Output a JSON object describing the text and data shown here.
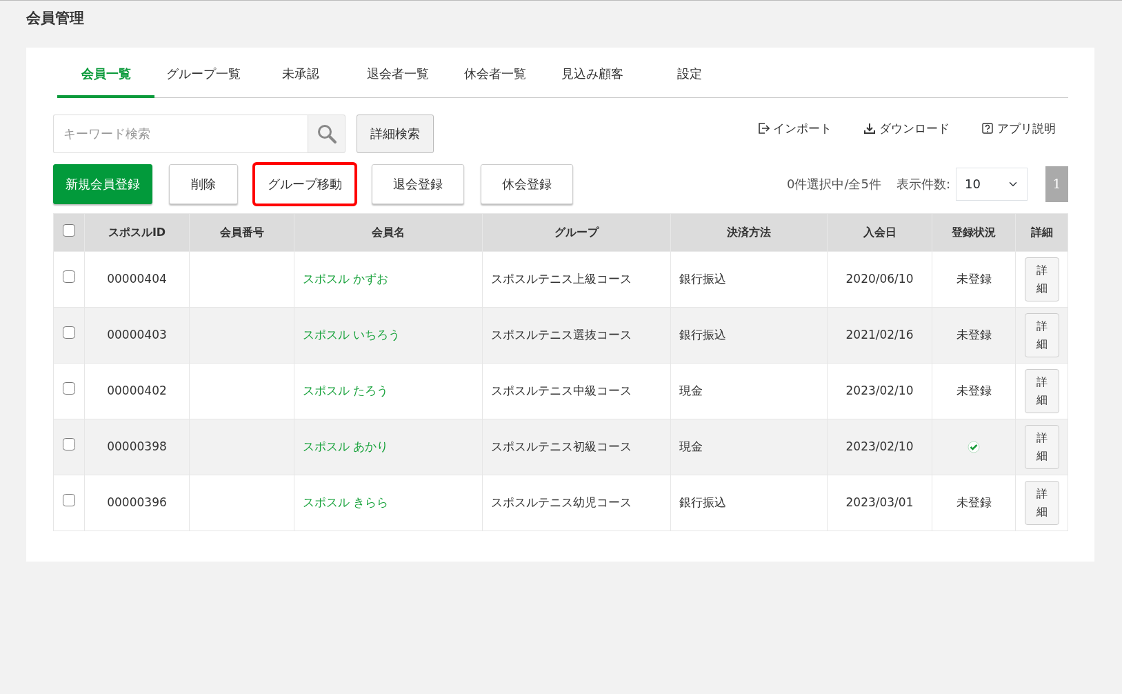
{
  "page_title": "会員管理",
  "tabs": [
    {
      "label": "会員一覧",
      "selected": true
    },
    {
      "label": "グループ一覧",
      "selected": false
    },
    {
      "label": "未承認",
      "selected": false
    },
    {
      "label": "退会者一覧",
      "selected": false
    },
    {
      "label": "休会者一覧",
      "selected": false
    },
    {
      "label": "見込み顧客",
      "selected": false
    },
    {
      "label": "設定",
      "selected": false
    }
  ],
  "search": {
    "placeholder": "キーワード検索",
    "advanced_button": "詳細検索"
  },
  "links": [
    {
      "kind": "import",
      "label": "インポート"
    },
    {
      "kind": "download",
      "label": "ダウンロード"
    },
    {
      "kind": "help",
      "label": "アプリ説明"
    }
  ],
  "actions": [
    {
      "kind": "primary",
      "label": "新規会員登録",
      "highlighted": false
    },
    {
      "kind": "default",
      "label": "削除",
      "highlighted": false
    },
    {
      "kind": "default",
      "label": "グループ移動",
      "highlighted": true
    },
    {
      "kind": "default",
      "label": "退会登録",
      "highlighted": false
    },
    {
      "kind": "default",
      "label": "休会登録",
      "highlighted": false
    }
  ],
  "selection_info": "0件選択中/全5件",
  "page_size_label": "表示件数:",
  "page_size": "10",
  "pages": [
    {
      "label": "1",
      "selected": true
    }
  ],
  "table": {
    "select_all_checked": false,
    "columns": [
      "スポスルID",
      "会員番号",
      "会員名",
      "グループ",
      "決済方法",
      "入会日",
      "登録状況",
      "詳細"
    ],
    "rows": [
      {
        "checked": false,
        "id": "00000404",
        "name": "スポスル かずお",
        "group": "スポスルテニス上級コース",
        "payment": "銀行振込",
        "joined": "2020/06/10",
        "registered": false,
        "status": "未登録",
        "detail": "詳細"
      },
      {
        "checked": false,
        "id": "00000403",
        "name": "スポスル いちろう",
        "group": "スポスルテニス選抜コース",
        "payment": "銀行振込",
        "joined": "2021/02/16",
        "registered": false,
        "status": "未登録",
        "detail": "詳細"
      },
      {
        "checked": false,
        "id": "00000402",
        "name": "スポスル たろう",
        "group": "スポスルテニス中級コース",
        "payment": "現金",
        "joined": "2023/02/10",
        "registered": false,
        "status": "未登録",
        "detail": "詳細"
      },
      {
        "checked": false,
        "id": "00000398",
        "name": "スポスル あかり",
        "group": "スポスルテニス初級コース",
        "payment": "現金",
        "joined": "2023/02/10",
        "registered": true,
        "detail": "詳細"
      },
      {
        "checked": false,
        "id": "00000396",
        "name": "スポスル きらら",
        "group": "スポスルテニス幼児コース",
        "payment": "銀行振込",
        "joined": "2023/03/01",
        "registered": false,
        "status": "未登録",
        "detail": "詳細"
      }
    ]
  }
}
